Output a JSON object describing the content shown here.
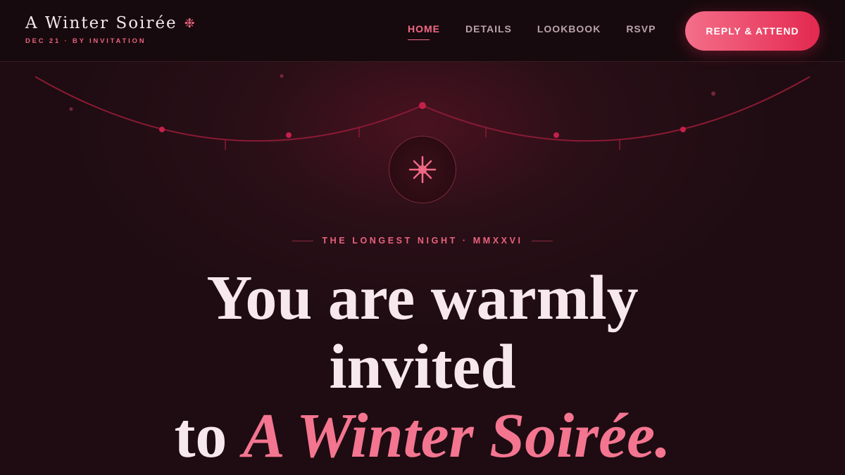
{
  "brand": {
    "title": "A Winter Soirée",
    "icon": "snowflake-icon",
    "subtitle": "DEC 21 · BY INVITATION"
  },
  "nav": {
    "items": [
      {
        "label": "HOME",
        "active": true
      },
      {
        "label": "DETAILS",
        "active": false
      },
      {
        "label": "LOOKBOOK",
        "active": false
      },
      {
        "label": "RSVP",
        "active": false
      }
    ]
  },
  "cta": {
    "label": "REPLY & ATTEND"
  },
  "hero": {
    "emblem_icon": "snowflake-icon",
    "eyebrow": "THE LONGEST NIGHT · MMXXVI",
    "headline_line1": "You are warmly",
    "headline_line2": "invited",
    "headline_prefix": "to",
    "headline_emphasis": "A Winter Soirée."
  },
  "colors": {
    "accent": "#e8627d",
    "accent_strong": "#e3284f",
    "background": "#1e0c12",
    "topbar": "#170a0e",
    "text": "#f5e6ea"
  }
}
